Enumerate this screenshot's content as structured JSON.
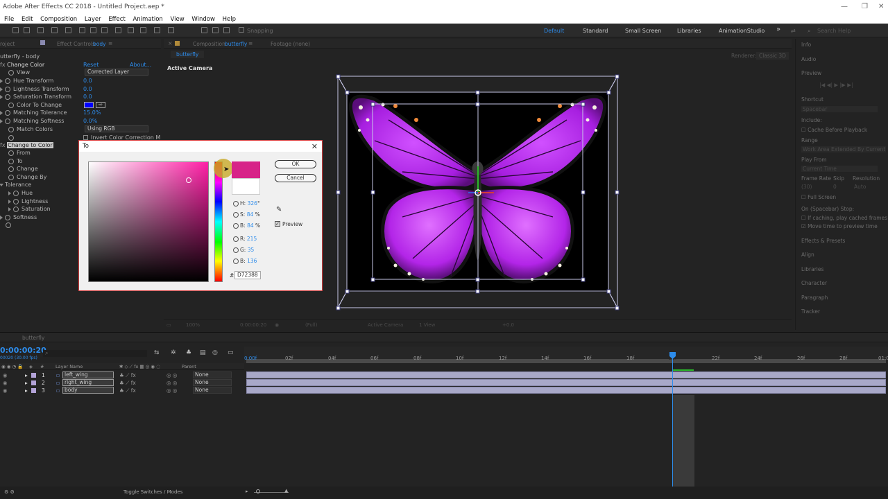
{
  "window": {
    "title": "Adobe After Effects CC 2018 - Untitled Project.aep *",
    "controls": [
      "—",
      "❐",
      "✕"
    ]
  },
  "menu": [
    "File",
    "Edit",
    "Composition",
    "Layer",
    "Effect",
    "Animation",
    "View",
    "Window",
    "Help"
  ],
  "toolbar": {
    "snapping": "Snapping",
    "workspaces": [
      "Default",
      "Standard",
      "Small Screen",
      "Libraries",
      "AnimationStudio"
    ],
    "overflow": "»",
    "search_placeholder": "Search Help"
  },
  "effect_controls": {
    "tabs": [
      "roject",
      "Effect Controls",
      "body"
    ],
    "layer_title": "utterfly - body",
    "effect1": {
      "name": "Change Color",
      "reset": "Reset",
      "about": "About...",
      "rows": [
        {
          "label": "View",
          "value": "Corrected Layer"
        },
        {
          "label": "Hue Transform",
          "value": "0.0"
        },
        {
          "label": "Lightness Transform",
          "value": "0.0"
        },
        {
          "label": "Saturation Transform",
          "value": "0.0"
        },
        {
          "label": "Color To Change",
          "value": ""
        },
        {
          "label": "Matching Tolerance",
          "value": "15.0%"
        },
        {
          "label": "Matching Softness",
          "value": "0.0%"
        },
        {
          "label": "Match Colors",
          "value": "Using RGB"
        },
        {
          "label": "Invert Color Correction M",
          "value": ""
        }
      ]
    },
    "effect2": {
      "name": "Change to Color",
      "rows": [
        "From",
        "To",
        "Change",
        "Change By"
      ],
      "tolerance": "Tolerance",
      "tolerance_rows": [
        "Hue",
        "Lightness",
        "Saturation"
      ],
      "softness": "Softness"
    },
    "swatch_color": "#0000ff"
  },
  "dialog": {
    "title": "To",
    "ok": "OK",
    "cancel": "Cancel",
    "preview": "Preview",
    "fields": {
      "h_label": "H:",
      "h": "326",
      "h_unit": "°",
      "s_label": "S:",
      "s": "84",
      "s_unit": "%",
      "b_label": "B:",
      "b": "84",
      "b_unit": "%",
      "r_label": "R:",
      "r": "215",
      "g_label": "G:",
      "g": "35",
      "bl_label": "B:",
      "bl": "136",
      "hash": "#",
      "hex": "D72388"
    },
    "new_color": "#d72388",
    "old_color": "#ffffff"
  },
  "composition": {
    "tabs": [
      "Composition",
      "butterfly",
      "Footage (none)"
    ],
    "sub_tab": "butterfly",
    "renderer_label": "Renderer:",
    "renderer_value": "Classic 3D",
    "view_label": "Active Camera",
    "footer": [
      "100%",
      "0:00:00:20",
      "(Full)",
      "Active Camera",
      "1 View",
      "+0.0"
    ]
  },
  "right_panel": {
    "items": [
      "Info",
      "Audio",
      "Preview",
      "Shortcut",
      "Spacebar",
      "Include:",
      "Cache Before Playback",
      "Range",
      "Work Area Extended By Current...",
      "Play From",
      "Current Time",
      "Frame Rate",
      "Skip",
      "Resolution",
      "(30)",
      "0",
      "Auto",
      "Full Screen",
      "On (Spacebar) Stop:",
      "If caching, play cached frames",
      "Move time to preview time",
      "Effects & Presets",
      "Align",
      "Libraries",
      "Character",
      "Paragraph",
      "Tracker"
    ]
  },
  "timeline": {
    "tab": "butterfly",
    "timecode": "0:00:00:20",
    "fps": "00020 (30.00 fps)",
    "columns": {
      "hash": "#",
      "layer_name": "Layer Name",
      "parent": "Parent"
    },
    "layers": [
      {
        "num": "1",
        "name": "left_wing",
        "parent": "None"
      },
      {
        "num": "2",
        "name": "right_wing",
        "parent": "None"
      },
      {
        "num": "3",
        "name": "body",
        "parent": "None"
      }
    ],
    "ruler": [
      "0:00f",
      "02f",
      "04f",
      "06f",
      "08f",
      "10f",
      "12f",
      "14f",
      "16f",
      "18f",
      "20f",
      "22f",
      "24f",
      "26f",
      "28f",
      "01:0"
    ],
    "toggle": "Toggle Switches / Modes"
  }
}
